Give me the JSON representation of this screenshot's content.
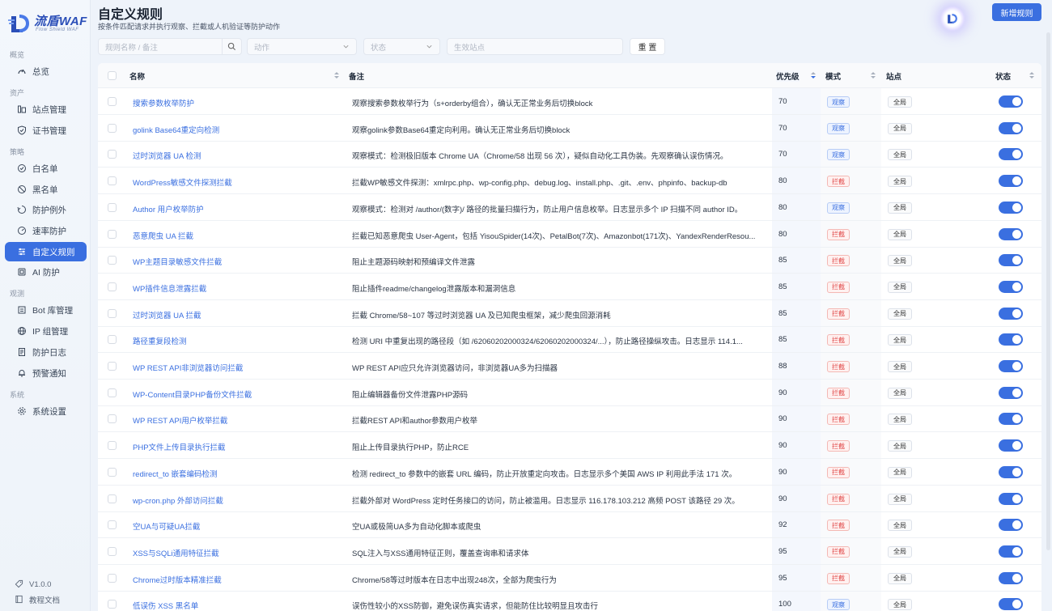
{
  "app": {
    "title": "流盾WAF",
    "subtitle": "Flow Shield WAF",
    "version": "V1.0.0",
    "docs": "教程文档"
  },
  "sidebar": {
    "sections": [
      {
        "label": "概览",
        "items": [
          {
            "label": "总览",
            "icon": "gauge-icon"
          }
        ]
      },
      {
        "label": "资产",
        "items": [
          {
            "label": "站点管理",
            "icon": "site-icon"
          },
          {
            "label": "证书管理",
            "icon": "shield-icon"
          }
        ]
      },
      {
        "label": "策略",
        "items": [
          {
            "label": "白名单",
            "icon": "check-circle-icon"
          },
          {
            "label": "黑名单",
            "icon": "ban-icon"
          },
          {
            "label": "防护例外",
            "icon": "exception-icon"
          },
          {
            "label": "速率防护",
            "icon": "speed-icon"
          },
          {
            "label": "自定义规则",
            "icon": "sliders-icon",
            "active": true
          },
          {
            "label": "AI 防护",
            "icon": "ai-icon"
          }
        ]
      },
      {
        "label": "观测",
        "items": [
          {
            "label": "Bot 库管理",
            "icon": "bot-icon"
          },
          {
            "label": "IP 组管理",
            "icon": "globe-icon"
          },
          {
            "label": "防护日志",
            "icon": "log-icon"
          },
          {
            "label": "预警通知",
            "icon": "bell-icon"
          }
        ]
      },
      {
        "label": "系统",
        "items": [
          {
            "label": "系统设置",
            "icon": "gear-icon"
          }
        ]
      }
    ]
  },
  "header": {
    "title": "自定义规则",
    "subtitle": "按条件匹配请求并执行观察、拦截或人机验证等防护动作",
    "new_button": "新增规则"
  },
  "filters": {
    "search_placeholder": "规则名称 / 备注",
    "action_placeholder": "动作",
    "status_placeholder": "状态",
    "site_placeholder": "生效站点",
    "reset": "重 置"
  },
  "table": {
    "columns": {
      "name": "名称",
      "note": "备注",
      "priority": "优先级",
      "mode": "模式",
      "site": "站点",
      "status": "状态"
    },
    "rows": [
      {
        "name": "搜索参数枚举防护",
        "note": "观察搜索参数枚举行为（s+orderby组合），确认无正常业务后切换block",
        "priority": "70",
        "mode": "观察",
        "mode_type": "observe",
        "site": "全局",
        "enabled": true
      },
      {
        "name": "golink Base64重定向检测",
        "note": "观察golink参数Base64重定向利用。确认无正常业务后切换block",
        "priority": "70",
        "mode": "观察",
        "mode_type": "observe",
        "site": "全局",
        "enabled": true
      },
      {
        "name": "过时浏览器 UA 检测",
        "note": "观察模式：检测极旧版本 Chrome UA（Chrome/58 出现 56 次），疑似自动化工具伪装。先观察确认误伤情况。",
        "priority": "70",
        "mode": "观察",
        "mode_type": "observe",
        "site": "全局",
        "enabled": true
      },
      {
        "name": "WordPress敏感文件探测拦截",
        "note": "拦截WP敏感文件探测：xmlrpc.php、wp-config.php、debug.log、install.php、.git、.env、phpinfo、backup-db",
        "priority": "80",
        "mode": "拦截",
        "mode_type": "block",
        "site": "全局",
        "enabled": true
      },
      {
        "name": "Author 用户枚举防护",
        "note": "观察模式：检测对 /author/(数字)/ 路径的批量扫描行为，防止用户信息枚举。日志显示多个 IP 扫描不同 author ID。",
        "priority": "80",
        "mode": "观察",
        "mode_type": "observe",
        "site": "全局",
        "enabled": true
      },
      {
        "name": "恶意爬虫 UA 拦截",
        "note": "拦截已知恶意爬虫 User-Agent，包括 YisouSpider(14次)、PetalBot(7次)、Amazonbot(171次)、YandexRenderResou...",
        "priority": "80",
        "mode": "拦截",
        "mode_type": "block",
        "site": "全局",
        "enabled": true
      },
      {
        "name": "WP主题目录敏感文件拦截",
        "note": "阻止主题源码映射和预编译文件泄露",
        "priority": "85",
        "mode": "拦截",
        "mode_type": "block",
        "site": "全局",
        "enabled": true
      },
      {
        "name": "WP插件信息泄露拦截",
        "note": "阻止插件readme/changelog泄露版本和漏洞信息",
        "priority": "85",
        "mode": "拦截",
        "mode_type": "block",
        "site": "全局",
        "enabled": true
      },
      {
        "name": "过时浏览器 UA 拦截",
        "note": "拦截 Chrome/58~107 等过时浏览器 UA 及已知爬虫框架，减少爬虫回源消耗",
        "priority": "85",
        "mode": "拦截",
        "mode_type": "block",
        "site": "全局",
        "enabled": true
      },
      {
        "name": "路径重复段检测",
        "note": "检测 URI 中重复出现的路径段（如 /62060202000324/62060202000324/...），防止路径操纵攻击。日志显示 114.1...",
        "priority": "85",
        "mode": "拦截",
        "mode_type": "block",
        "site": "全局",
        "enabled": true
      },
      {
        "name": "WP REST API非浏览器访问拦截",
        "note": "WP REST API应只允许浏览器访问，非浏览器UA多为扫描器",
        "priority": "88",
        "mode": "拦截",
        "mode_type": "block",
        "site": "全局",
        "enabled": true
      },
      {
        "name": "WP-Content目录PHP备份文件拦截",
        "note": "阻止编辑器备份文件泄露PHP源码",
        "priority": "90",
        "mode": "拦截",
        "mode_type": "block",
        "site": "全局",
        "enabled": true
      },
      {
        "name": "WP REST API用户枚举拦截",
        "note": "拦截REST API和author参数用户枚举",
        "priority": "90",
        "mode": "拦截",
        "mode_type": "block",
        "site": "全局",
        "enabled": true
      },
      {
        "name": "PHP文件上传目录执行拦截",
        "note": "阻止上传目录执行PHP，防止RCE",
        "priority": "90",
        "mode": "拦截",
        "mode_type": "block",
        "site": "全局",
        "enabled": true
      },
      {
        "name": "redirect_to 嵌套编码检测",
        "note": "检测 redirect_to 参数中的嵌套 URL 编码，防止开放重定向攻击。日志显示多个美国 AWS IP 利用此手法 171 次。",
        "priority": "90",
        "mode": "拦截",
        "mode_type": "block",
        "site": "全局",
        "enabled": true
      },
      {
        "name": "wp-cron.php 外部访问拦截",
        "note": "拦截外部对 WordPress 定时任务接口的访问，防止被滥用。日志显示 116.178.103.212 高频 POST 该路径 29 次。",
        "priority": "90",
        "mode": "拦截",
        "mode_type": "block",
        "site": "全局",
        "enabled": true
      },
      {
        "name": "空UA与可疑UA拦截",
        "note": "空UA或极简UA多为自动化脚本或爬虫",
        "priority": "92",
        "mode": "拦截",
        "mode_type": "block",
        "site": "全局",
        "enabled": true
      },
      {
        "name": "XSS与SQLi通用特征拦截",
        "note": "SQL注入与XSS通用特征正则，覆盖查询串和请求体",
        "priority": "95",
        "mode": "拦截",
        "mode_type": "block",
        "site": "全局",
        "enabled": true
      },
      {
        "name": "Chrome过时版本精准拦截",
        "note": "Chrome/58等过时版本在日志中出现248次，全部为爬虫行为",
        "priority": "95",
        "mode": "拦截",
        "mode_type": "block",
        "site": "全局",
        "enabled": true
      },
      {
        "name": "低误伤 XSS 黑名单",
        "note": "误伤性较小的XSS防御，避免误伤真实请求，但能防住比较明显且攻击行",
        "priority": "100",
        "mode": "观察",
        "mode_type": "observe",
        "site": "全局",
        "enabled": true
      }
    ]
  },
  "colors": {
    "accent": "#3a6fe0",
    "observe": "#3a6fe0",
    "block": "#e04848"
  }
}
